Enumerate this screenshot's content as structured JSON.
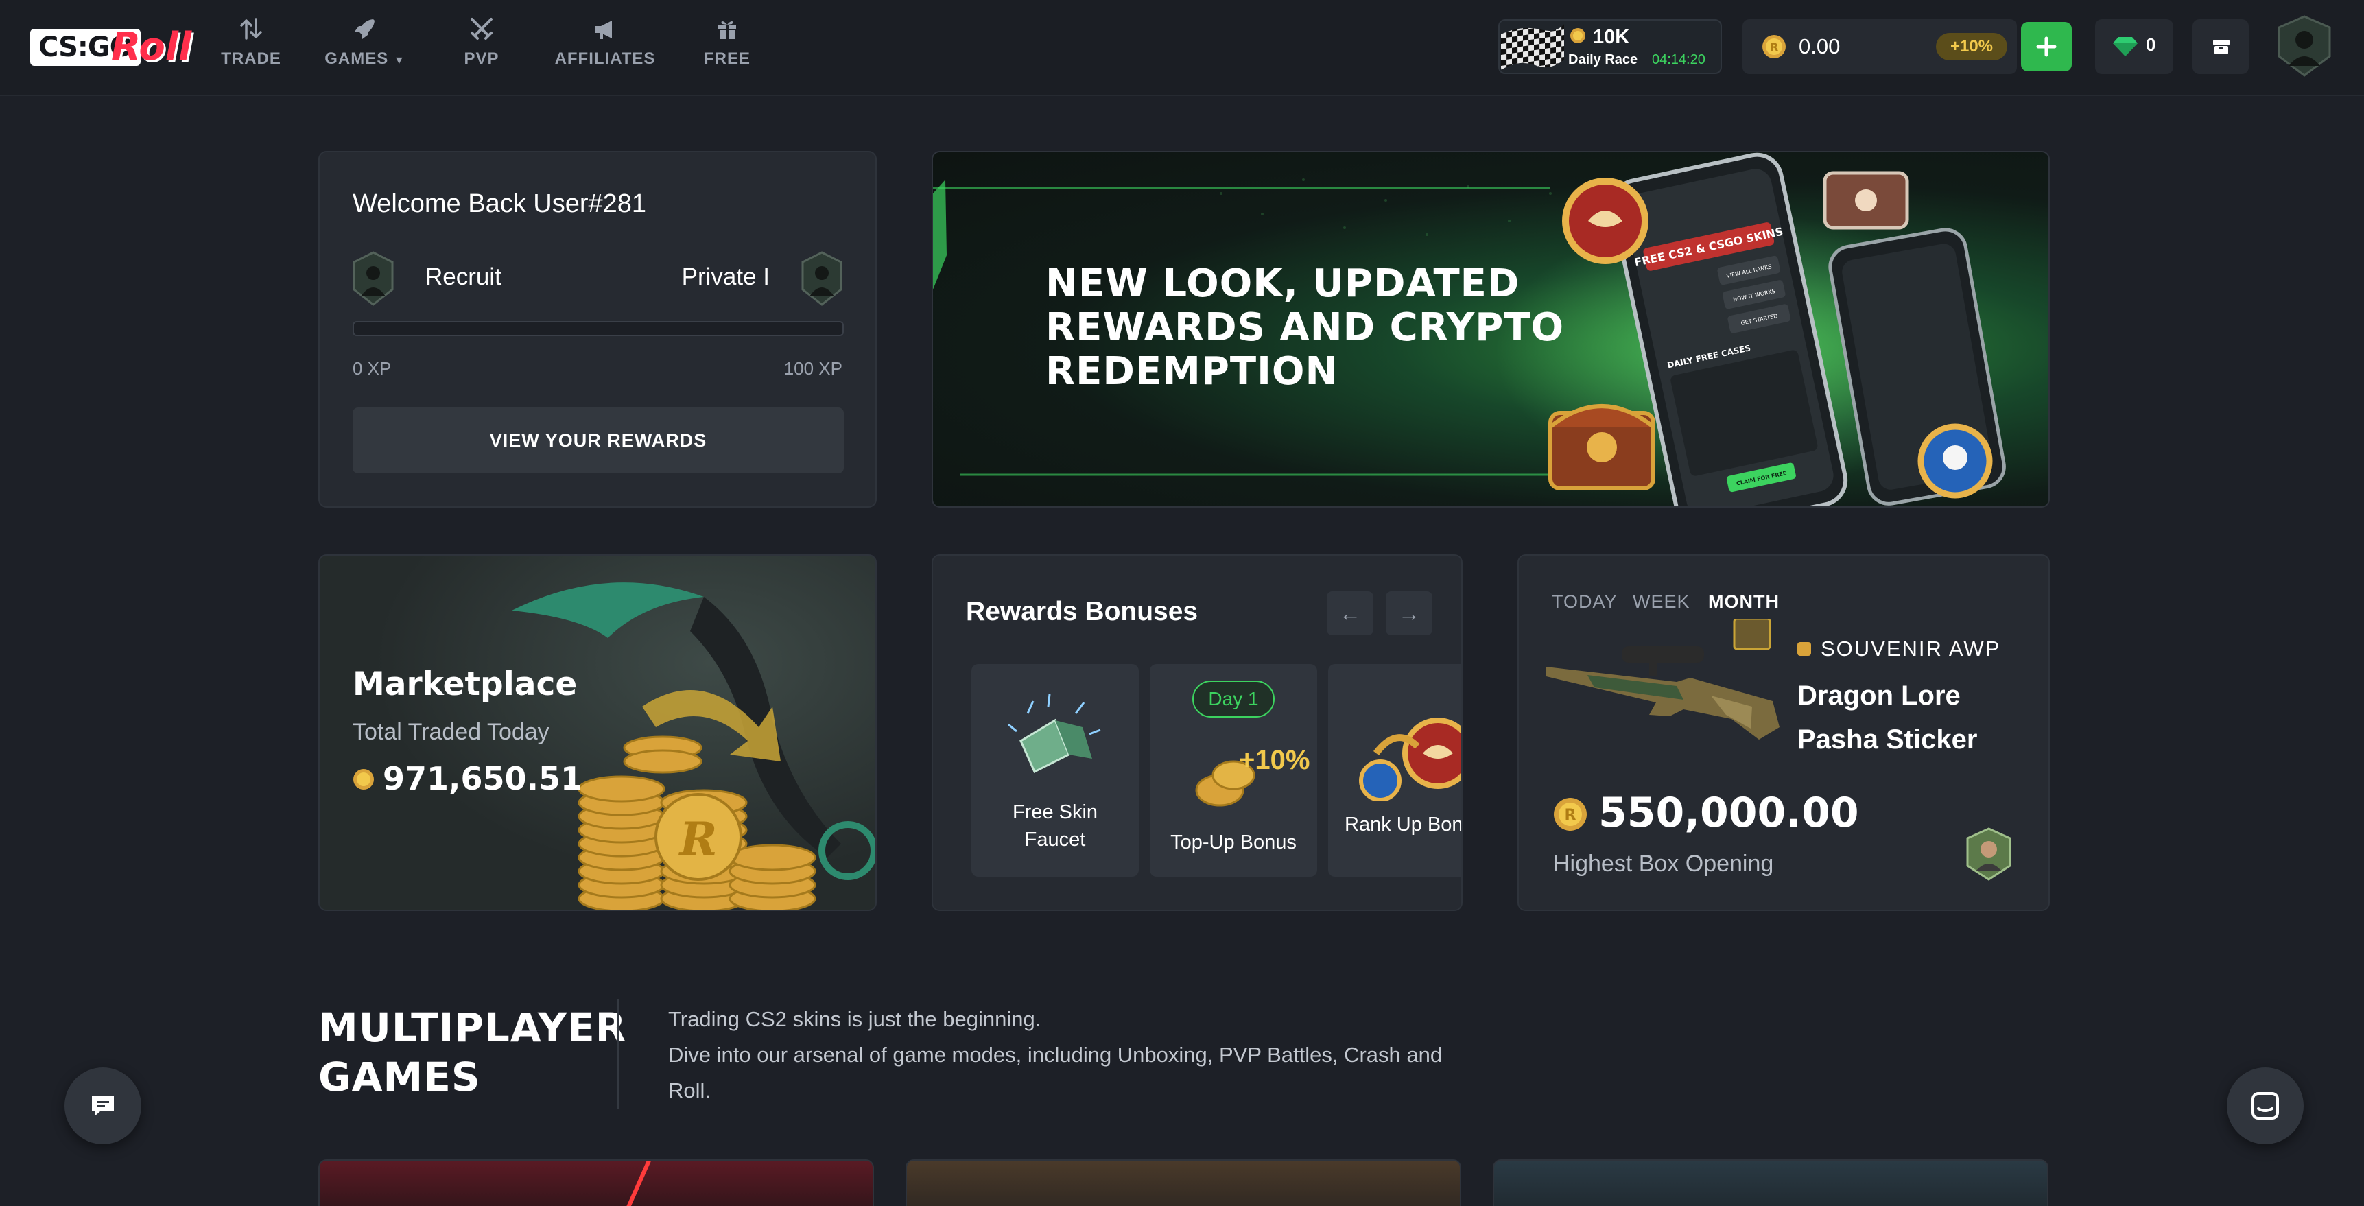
{
  "header": {
    "logo_main": "CS:GO",
    "logo_accent": "Roll",
    "nav": [
      {
        "label": "TRADE",
        "icon": "trade-arrows-icon"
      },
      {
        "label": "GAMES",
        "icon": "rocket-icon"
      },
      {
        "label": "PVP",
        "icon": "crossed-swords-icon"
      },
      {
        "label": "AFFILIATES",
        "icon": "megaphone-icon"
      },
      {
        "label": "FREE",
        "icon": "gift-icon"
      }
    ],
    "race": {
      "amount": "10K",
      "label": "Daily Race",
      "timer": "04:14:20"
    },
    "balance": {
      "amount": "0.00",
      "bonus": "+10%"
    },
    "deposit_label": "+",
    "gems": "0",
    "colors": {
      "accent_green": "#3cd35f",
      "brand_red": "#ff2f4b",
      "coin_gold": "#f2c94c"
    }
  },
  "welcome": {
    "title": "Welcome Back User#281",
    "rank_current": "Recruit",
    "rank_next": "Private I",
    "xp_start": "0 XP",
    "xp_end": "100 XP",
    "xp_progress": 0,
    "button": "VIEW YOUR REWARDS"
  },
  "banner": {
    "headline": "NEW LOOK, UPDATED\nREWARDS AND CRYPTO\nREDEMPTION",
    "phone": {
      "title": "FREE CS2 & CSGO SKINS",
      "section": "DAILY FREE CASES",
      "cta": "CLAIM FOR FREE",
      "buttons": [
        "VIEW ALL RANKS",
        "HOW IT WORKS",
        "GET STARTED"
      ]
    }
  },
  "marketplace": {
    "title": "Marketplace",
    "subtitle": "Total Traded Today",
    "value": "971,650.51"
  },
  "rewards": {
    "title": "Rewards Bonuses",
    "prev": "←",
    "next": "→",
    "items": [
      {
        "label": "Free Skin\nFaucet"
      },
      {
        "label": "Top-Up Bonus",
        "badge": "Day 1",
        "overlay": "+10%"
      },
      {
        "label": "Rank Up Bonus"
      }
    ]
  },
  "highest": {
    "periods": [
      "TODAY",
      "WEEK",
      "MONTH"
    ],
    "active_period": "MONTH",
    "tag": "SOUVENIR AWP",
    "item_name": "Dragon Lore\nPasha Sticker",
    "price": "550,000.00",
    "subtitle": "Highest Box Opening"
  },
  "multiplayer": {
    "title": "MULTIPLAYER\nGAMES",
    "desc_line1": "Trading CS2 skins is just the beginning.",
    "desc_line2": "Dive into our arsenal of game modes, including Unboxing, PVP Battles, Crash and",
    "desc_line3": "Roll."
  }
}
